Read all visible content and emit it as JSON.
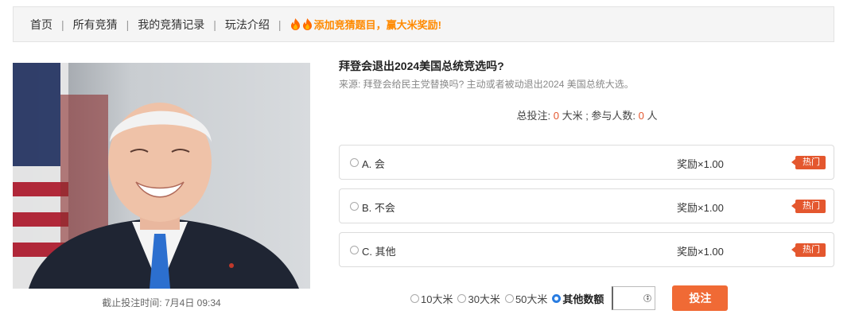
{
  "nav": {
    "items": [
      "首页",
      "所有竞猜",
      "我的竞猜记录",
      "玩法介绍"
    ],
    "separator": "|",
    "promo": "添加竞猜题目，赢大米奖励!"
  },
  "question": {
    "title": "拜登会退出2024美国总统竞选吗?",
    "source": "来源: 拜登会给民主党替换吗? 主动或者被动退出2024 美国总统大选。",
    "totals_label_1": "总投注: ",
    "total_bets": "0",
    "totals_label_2": " 大米 ; 参与人数: ",
    "participants": "0",
    "totals_label_3": " 人",
    "deadline": "截止投注时间: 7月4日 09:34"
  },
  "options": [
    {
      "label": "A. 会",
      "reward": "奖励×1.00",
      "tag": "热门"
    },
    {
      "label": "B. 不会",
      "reward": "奖励×1.00",
      "tag": "热门"
    },
    {
      "label": "C. 其他",
      "reward": "奖励×1.00",
      "tag": "热门"
    }
  ],
  "bet": {
    "amounts": [
      "10大米",
      "30大米",
      "50大米",
      "其他数额"
    ],
    "selected": "其他数额",
    "custom_value": "",
    "submit_label": "投注"
  },
  "colors": {
    "accent": "#e4572e",
    "promo": "#ff8a00",
    "submit": "#f06a35",
    "radio_selected": "#2a7de1"
  }
}
